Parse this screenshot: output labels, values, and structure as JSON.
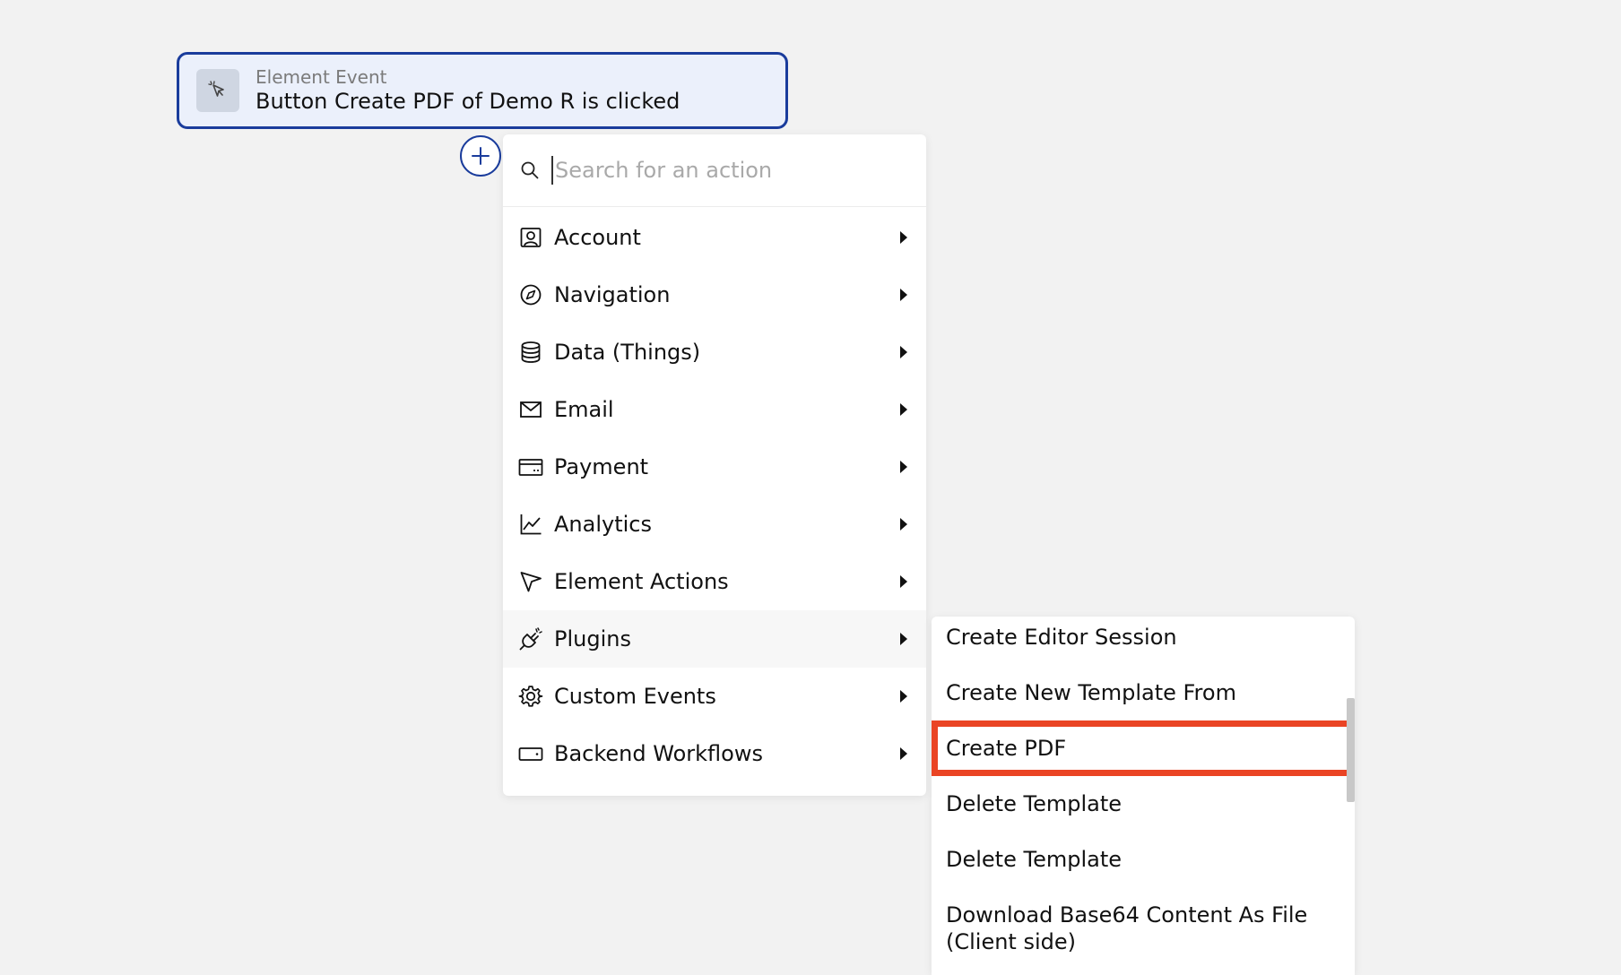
{
  "event_card": {
    "kind": "Element Event",
    "title": "Button Create PDF of Demo R is clicked",
    "icon": "cursor-click-icon"
  },
  "add_button": {
    "icon": "plus-icon",
    "accent": "#1a3c9c"
  },
  "search": {
    "placeholder": "Search for an action",
    "value": ""
  },
  "menu": {
    "items": [
      {
        "label": "Account",
        "icon": "account-icon"
      },
      {
        "label": "Navigation",
        "icon": "compass-icon"
      },
      {
        "label": "Data (Things)",
        "icon": "database-icon"
      },
      {
        "label": "Email",
        "icon": "envelope-icon"
      },
      {
        "label": "Payment",
        "icon": "credit-card-icon"
      },
      {
        "label": "Analytics",
        "icon": "chart-line-icon"
      },
      {
        "label": "Element Actions",
        "icon": "pointer-icon"
      },
      {
        "label": "Plugins",
        "icon": "plug-icon",
        "active": true
      },
      {
        "label": "Custom Events",
        "icon": "gear-icon"
      },
      {
        "label": "Backend Workflows",
        "icon": "server-icon"
      }
    ]
  },
  "submenu": {
    "items": [
      {
        "label": "Create Editor Session"
      },
      {
        "label": "Create New Template From"
      },
      {
        "label": "Create PDF",
        "highlighted": true
      },
      {
        "label": "Delete Template"
      },
      {
        "label": "Delete Template"
      },
      {
        "label": "Download Base64 Content As File (Client side)"
      }
    ]
  },
  "colors": {
    "highlight": "#ea4424",
    "background": "#f2f2f2",
    "card_fill": "#ebf0fb"
  }
}
